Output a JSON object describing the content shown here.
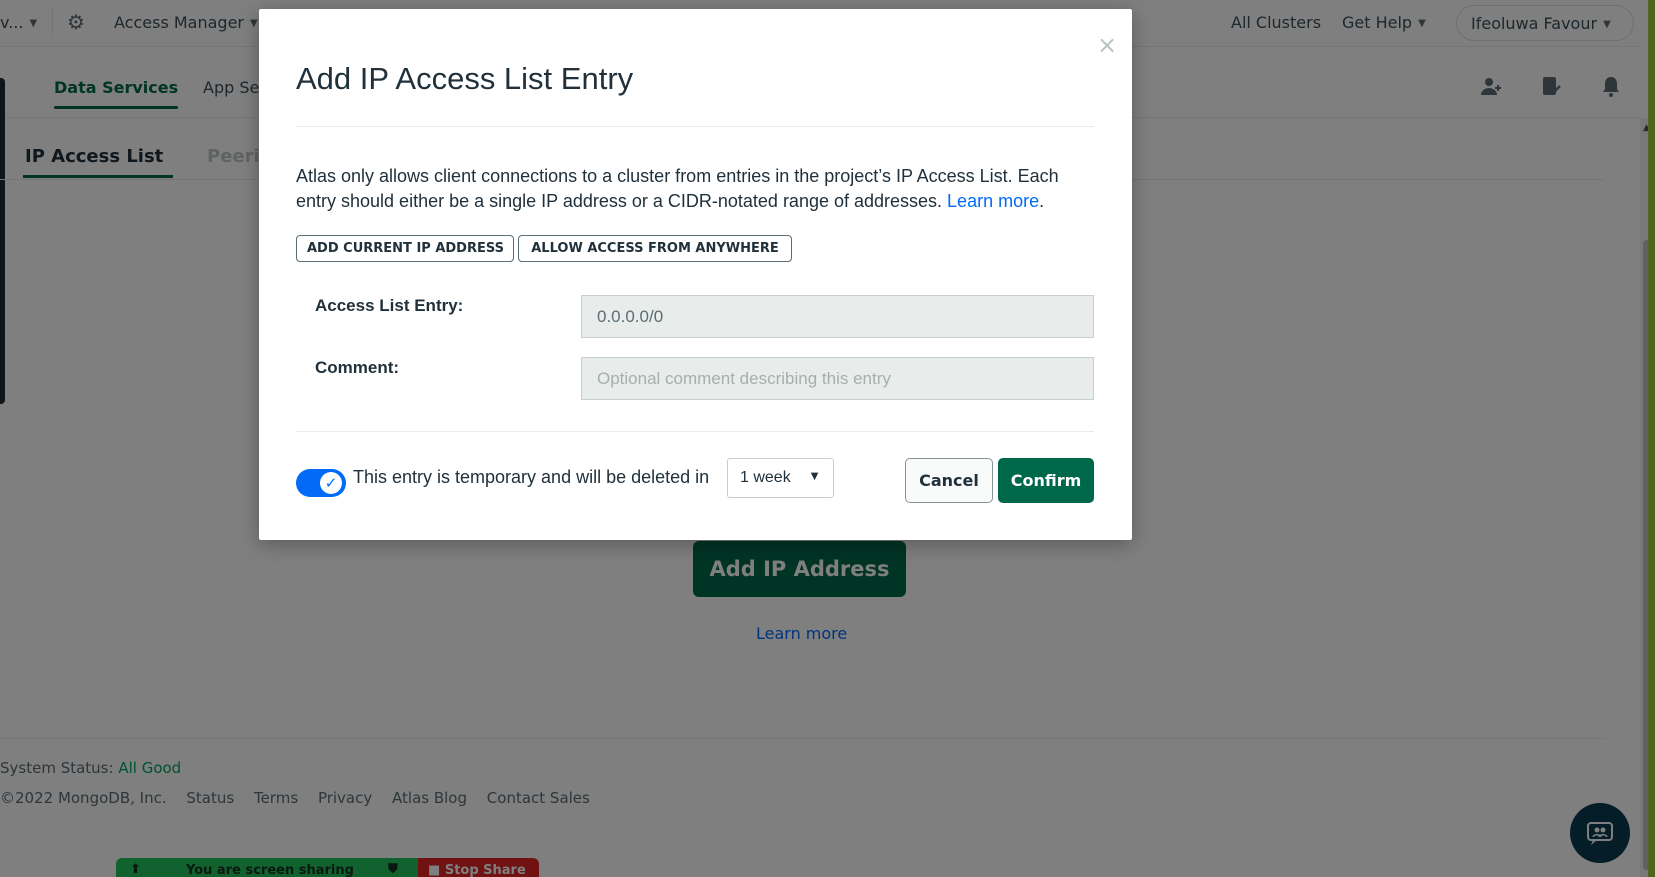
{
  "topbar": {
    "org_fragment": "v...",
    "access_manager": "Access Manager",
    "all_clusters": "All Clusters",
    "get_help": "Get Help",
    "user_name": "Ifeoluwa Favour"
  },
  "subnav": {
    "data_services": "Data Services",
    "app_services": "App Se",
    "icons": [
      "invite-user-icon",
      "activity-icon",
      "bell-icon"
    ]
  },
  "page_tabs": {
    "ip_access_list": "IP Access List",
    "peering": "Peerin"
  },
  "background": {
    "add_ip_button": "Add IP Address",
    "learn_more": "Learn more"
  },
  "footer": {
    "status_label": "System Status:",
    "status_value": "All Good",
    "copyright": "©2022 MongoDB, Inc.",
    "links": [
      "Status",
      "Terms",
      "Privacy",
      "Atlas Blog",
      "Contact Sales"
    ]
  },
  "share_bar": {
    "sharing_text": "You are screen sharing",
    "stop_label": "Stop Share"
  },
  "modal": {
    "close_glyph": "×",
    "title": "Add IP Access List Entry",
    "description": "Atlas only allows client connections to a cluster from entries in the project’s IP Access List. Each entry should either be a single IP address or a CIDR-notated range of addresses. ",
    "learn_more": "Learn more",
    "add_current_ip": "ADD CURRENT IP ADDRESS",
    "allow_anywhere": "ALLOW ACCESS FROM ANYWHERE",
    "access_list_label": "Access List Entry:",
    "access_list_value": "0.0.0.0/0",
    "comment_label": "Comment:",
    "comment_placeholder": "Optional comment describing this entry",
    "temporary_text": "This entry is temporary and will be deleted in",
    "temporary_enabled": true,
    "duration_selected": "1 week",
    "cancel_label": "Cancel",
    "confirm_label": "Confirm"
  },
  "colors": {
    "brand_green": "#00684a",
    "link_blue": "#016bf8",
    "status_green": "#00a35c",
    "overlay": "rgba(0,0,0,0.5)"
  }
}
